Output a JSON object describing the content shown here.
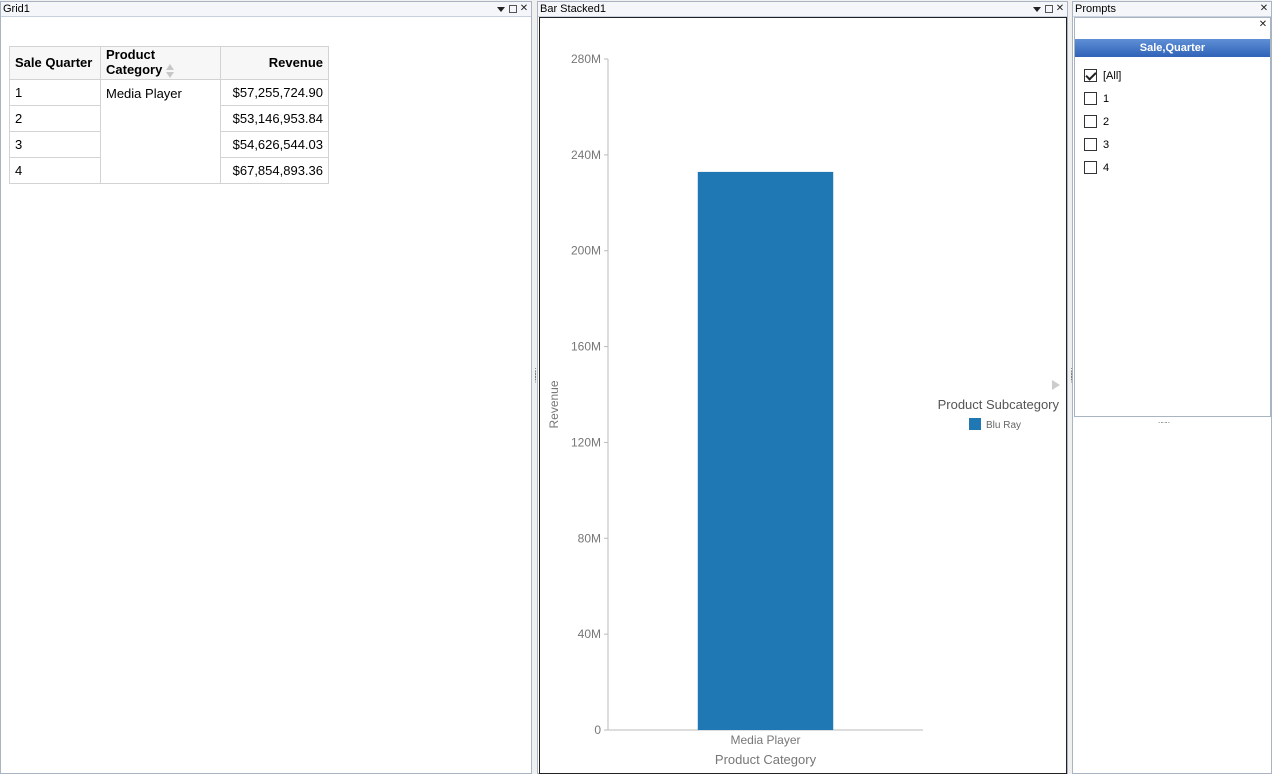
{
  "grid_panel": {
    "title": "Grid1",
    "columns": [
      "Sale Quarter",
      "Product Category",
      "Revenue"
    ],
    "category": "Media Player",
    "rows": [
      {
        "quarter": "1",
        "revenue": "$57,255,724.90"
      },
      {
        "quarter": "2",
        "revenue": "$53,146,953.84"
      },
      {
        "quarter": "3",
        "revenue": "$54,626,544.03"
      },
      {
        "quarter": "4",
        "revenue": "$67,854,893.36"
      }
    ]
  },
  "chart_panel": {
    "title": "Bar Stacked1"
  },
  "chart_data": {
    "type": "bar",
    "stacked": true,
    "categories": [
      "Media Player"
    ],
    "series": [
      {
        "name": "Blu Ray",
        "values": [
          232884116.13
        ],
        "color": "#1f77b4"
      }
    ],
    "xlabel": "Product Category",
    "ylabel": "Revenue",
    "ylim": [
      0,
      280000000
    ],
    "yticks": [
      0,
      40000000,
      80000000,
      120000000,
      160000000,
      200000000,
      240000000,
      280000000
    ],
    "ytick_labels": [
      "0",
      "40M",
      "80M",
      "120M",
      "160M",
      "200M",
      "240M",
      "280M"
    ],
    "legend_title": "Product Subcategory",
    "legend_position": "right",
    "grid": false
  },
  "prompts_panel": {
    "title": "Prompts",
    "header": "Sale,Quarter",
    "options": [
      {
        "label": "[All]",
        "checked": true
      },
      {
        "label": "1",
        "checked": false
      },
      {
        "label": "2",
        "checked": false
      },
      {
        "label": "3",
        "checked": false
      },
      {
        "label": "4",
        "checked": false
      }
    ]
  },
  "icons": {
    "dropdown": "chevron-down-icon",
    "maximize": "maximize-icon",
    "close": "close-icon",
    "close_glyph": "✕"
  }
}
